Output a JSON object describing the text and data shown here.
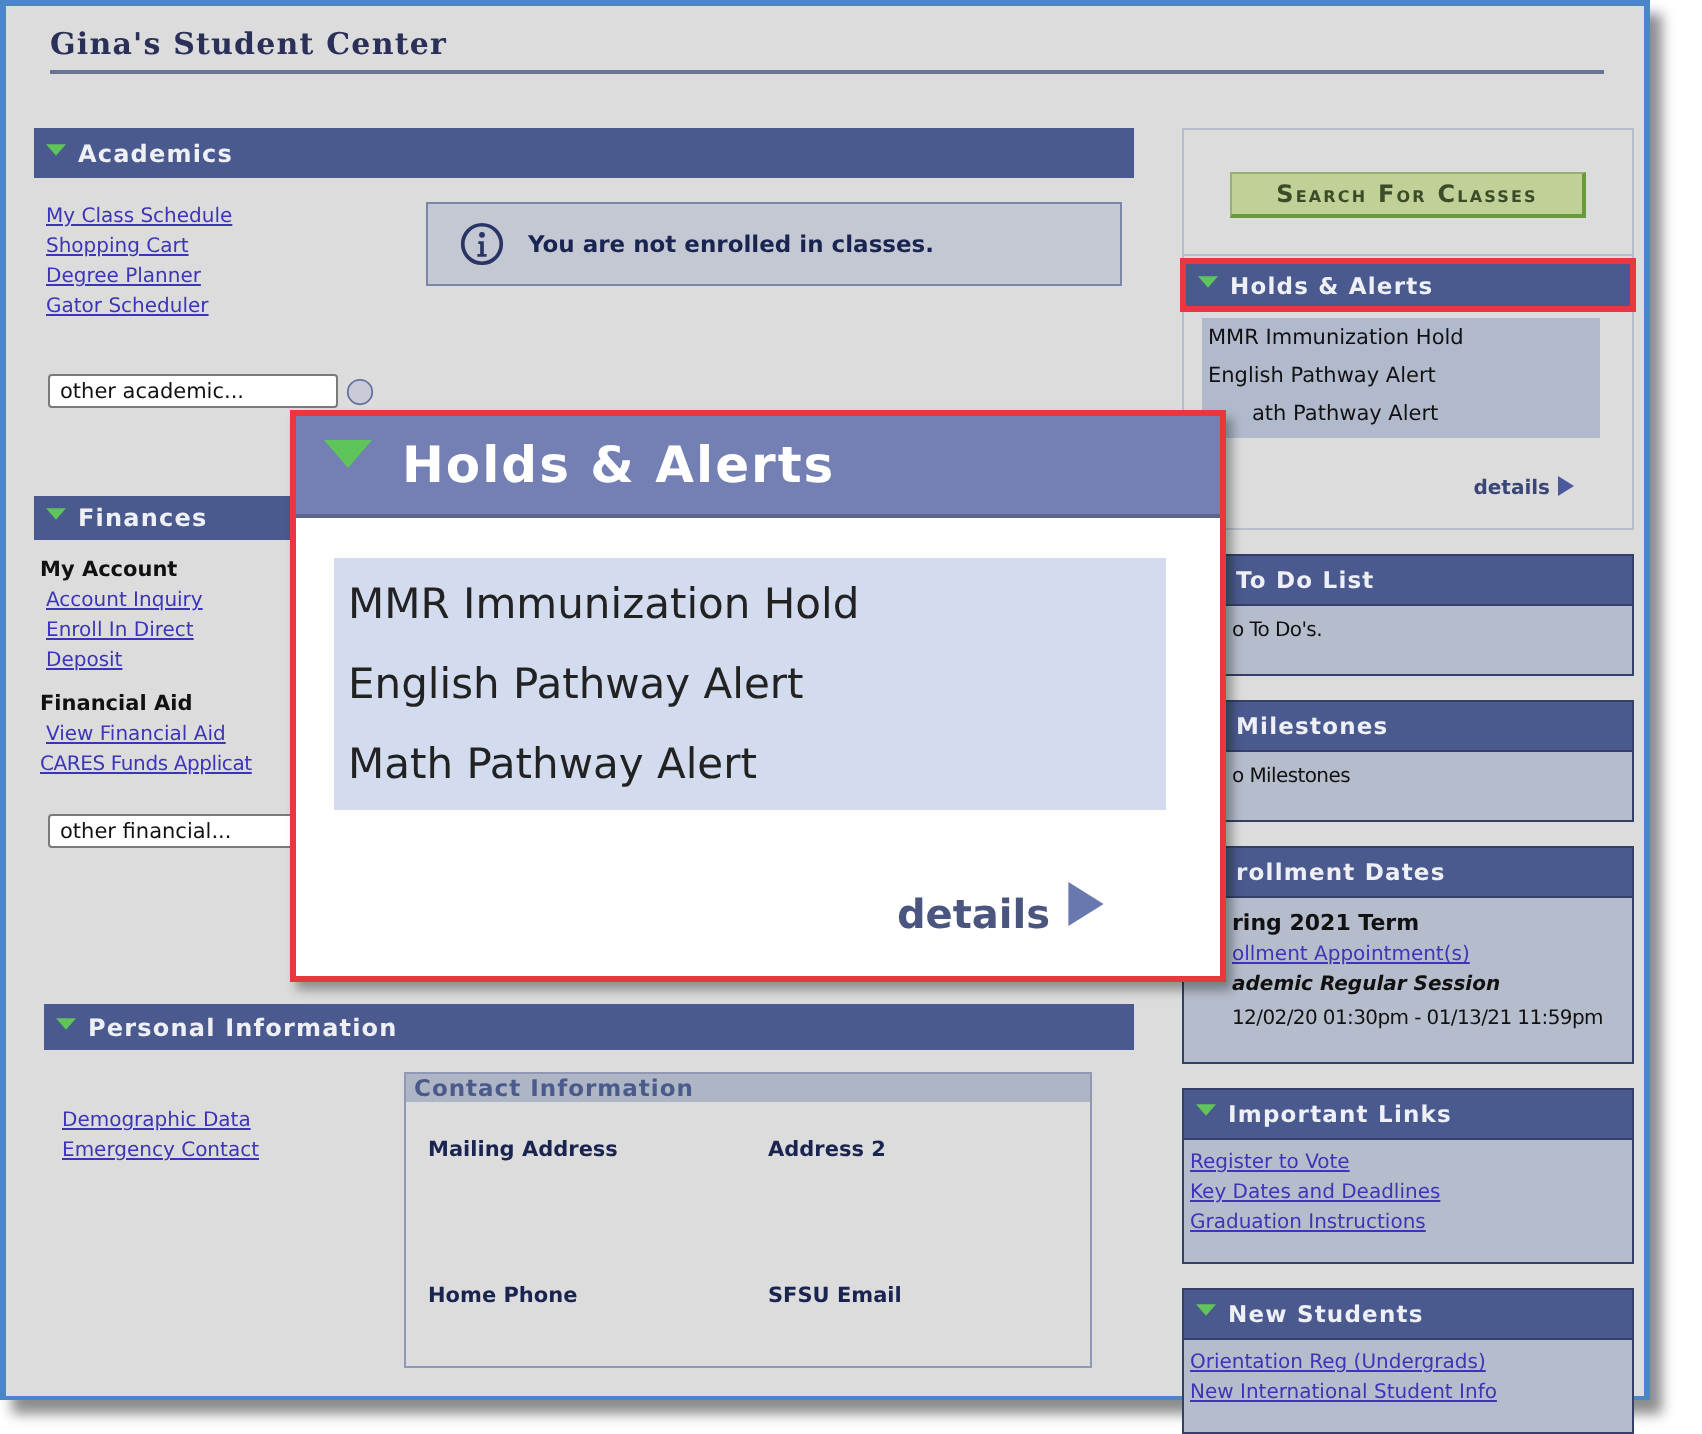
{
  "page_title": "Gina's Student Center",
  "academics": {
    "title": "Academics",
    "links": [
      "My Class Schedule",
      "Shopping Cart",
      "Degree Planner",
      "Gator Scheduler"
    ],
    "notice": "You are not enrolled in classes.",
    "select": {
      "value": "other academic..."
    }
  },
  "finances": {
    "title": "Finances",
    "groups": [
      {
        "heading": "My Account",
        "links": [
          "Account Inquiry",
          "Enroll In Direct",
          "Deposit"
        ]
      },
      {
        "heading": "Financial Aid",
        "links": [
          "View Financial Aid",
          "CARES Funds Applicat"
        ]
      }
    ],
    "select": {
      "value": "other financial..."
    }
  },
  "personal_information": {
    "title": "Personal Information",
    "links": [
      "Demographic Data",
      "Emergency Contact"
    ],
    "contact": {
      "title": "Contact Information",
      "fields": [
        "Mailing Address",
        "Address 2",
        "Home Phone",
        "SFSU Email"
      ]
    }
  },
  "search_button": "Search For Classes",
  "sidebar": [
    {
      "kind": "holds",
      "title": "Holds & Alerts",
      "icon": true,
      "highlighted": true,
      "items": [
        "MMR Immunization Hold",
        "English Pathway Alert",
        "ath Pathway Alert"
      ],
      "details": "details"
    },
    {
      "kind": "panel",
      "title": "To Do List",
      "lines": [
        {
          "kind": "text",
          "text": "o To Do's."
        }
      ]
    },
    {
      "kind": "panel",
      "title": "Milestones",
      "lines": [
        {
          "kind": "text",
          "text": "o Milestones"
        }
      ]
    },
    {
      "kind": "panel",
      "title": "rollment Dates",
      "lines": [
        {
          "kind": "heading",
          "text": "ring 2021 Term"
        },
        {
          "kind": "link",
          "text": "ollment Appointment(s)"
        },
        {
          "kind": "session",
          "text": "ademic Regular Session"
        },
        {
          "kind": "text",
          "text": "12/02/20 01:30pm - 01/13/21 11:59pm"
        }
      ]
    },
    {
      "kind": "panel",
      "title": "Important Links",
      "icon": true,
      "lines": [
        {
          "kind": "link",
          "text": "Register to Vote"
        },
        {
          "kind": "link",
          "text": "Key Dates and Deadlines"
        },
        {
          "kind": "link",
          "text": "Graduation Instructions"
        }
      ]
    },
    {
      "kind": "panel",
      "title": "New Students",
      "icon": true,
      "lines": [
        {
          "kind": "link",
          "text": "Orientation Reg (Undergrads)"
        },
        {
          "kind": "link",
          "text": "New International Student Info"
        }
      ]
    }
  ],
  "callout": {
    "title": "Holds & Alerts",
    "items": [
      "MMR Immunization Hold",
      "English Pathway Alert",
      "Math Pathway Alert"
    ],
    "details": "details"
  }
}
